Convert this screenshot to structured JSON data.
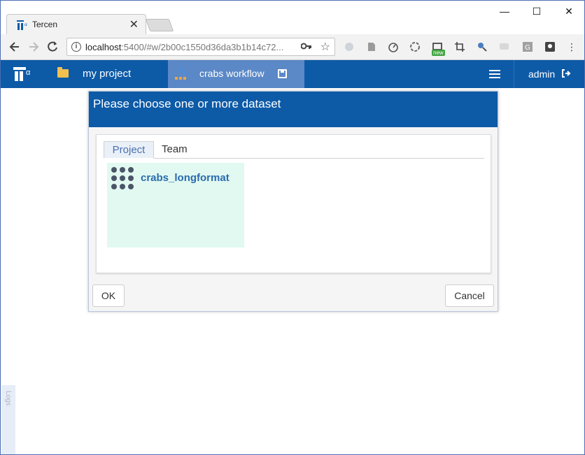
{
  "browser": {
    "tab_title": "Tercen",
    "tab_close": "✕",
    "window_controls": [
      "—",
      "☐",
      "✕"
    ],
    "url_host": "localhost",
    "url_rest": ":5400/#w/2b00c1550d36da3b1b14c72...",
    "ext_new_badge": "new",
    "icons": [
      "back-icon",
      "forward-icon",
      "reload-icon",
      "info-icon",
      "key-icon",
      "star-icon"
    ]
  },
  "app": {
    "project_label": "my project",
    "workflow_label": "crabs workflow",
    "user_label": "admin",
    "logo_alpha": "α",
    "colors": {
      "primary": "#0d5aa7",
      "active_tab": "#5b88c6",
      "folder": "#f3c04f"
    }
  },
  "dialog": {
    "title": "Please choose one or more dataset",
    "tabs": [
      "Project",
      "Team"
    ],
    "datasets": [
      {
        "name": "crabs_longformat"
      }
    ],
    "ok_label": "OK",
    "cancel_label": "Cancel"
  },
  "side_handle": {
    "label": "Logs"
  }
}
